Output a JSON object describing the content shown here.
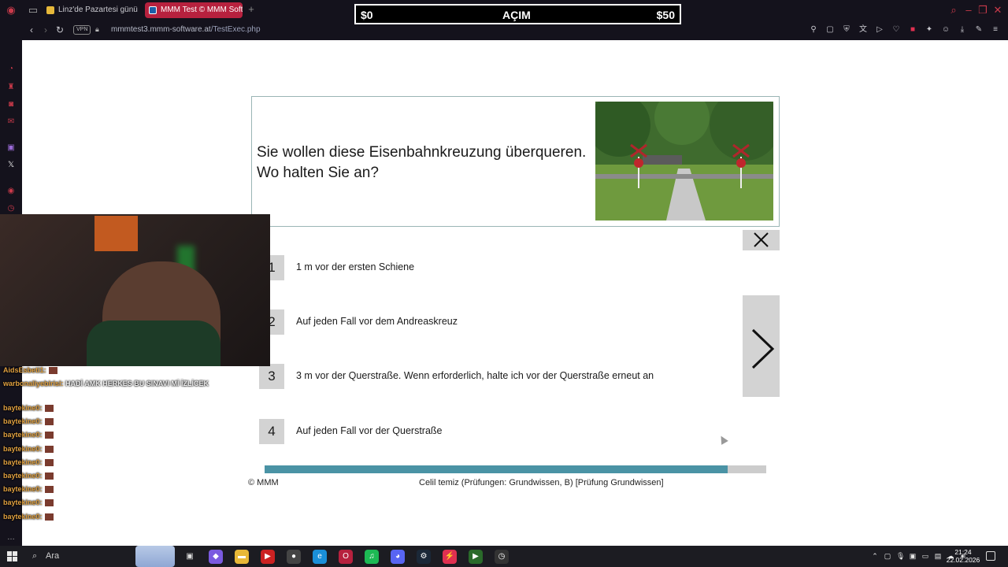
{
  "browser": {
    "tabs": [
      {
        "label": "Linz'de Pazartesi günü sa"
      },
      {
        "label": "MMM Test © MMM Softwa"
      }
    ],
    "new_tab": "+",
    "vpn": "VPN",
    "url_host": "mmmtest3.mmm-software.at",
    "url_path": "/TestExec.php",
    "accent": "#b7213e"
  },
  "overlay": {
    "left_amount": "$0",
    "center_text": "AÇIM",
    "right_amount": "$50"
  },
  "quiz": {
    "question": "Sie wollen diese Eisenbahnkreuzung überqueren. Wo halten Sie an?",
    "image_alt": "railroad-crossing-photo",
    "answers": [
      {
        "number": "1",
        "text": "1 m vor der ersten Schiene"
      },
      {
        "number": "2",
        "text": "Auf jeden Fall vor dem Andreaskreuz"
      },
      {
        "number": "3",
        "text": "3 m vor der Querstraße. Wenn erforderlich, halte ich vor der Querstraße erneut an"
      },
      {
        "number": "4",
        "text": "Auf jeden Fall vor der Querstraße"
      }
    ],
    "progress_fraction": 0.923,
    "progress_color": "#4a93a5",
    "copyright": "© MMM",
    "footer_info": "Celil temiz (Prüfungen: Grundwissen, B) [Prüfung Grundwissen]"
  },
  "chat": {
    "lines": [
      {
        "user": "AidsEsbeti1:",
        "msg": ""
      },
      {
        "user": "warbonaliyebirisi:",
        "msg": "HADİ AMK HERKES BU SINAVI Mİ İZLİCEK"
      },
      {
        "user": "baytekine0:",
        "msg": ""
      },
      {
        "user": "baytekine0:",
        "msg": ""
      },
      {
        "user": "baytekine0:",
        "msg": ""
      },
      {
        "user": "baytekine0:",
        "msg": ""
      },
      {
        "user": "baytekine0:",
        "msg": ""
      },
      {
        "user": "baytekine0:",
        "msg": ""
      },
      {
        "user": "baytekine0:",
        "msg": ""
      },
      {
        "user": "baytekine0:",
        "msg": ""
      },
      {
        "user": "baytekine0:",
        "msg": ""
      }
    ]
  },
  "taskbar": {
    "search_label": "Ara",
    "time": "21:24",
    "date": "22.02.2026"
  }
}
